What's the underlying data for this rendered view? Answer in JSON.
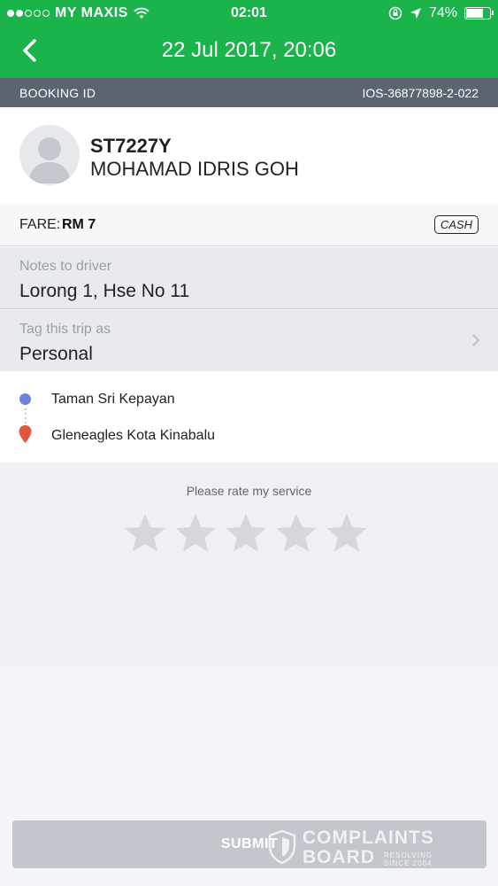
{
  "status_bar": {
    "carrier": "MY MAXIS",
    "time": "02:01",
    "battery": "74%",
    "battery_level": 0.74,
    "signal_bars_filled": 2,
    "signal_bars_total": 5
  },
  "header": {
    "title": "22 Jul 2017, 20:06",
    "back_icon": "chevron-left-icon",
    "background_color": "#1ab44a"
  },
  "booking": {
    "label": "BOOKING ID",
    "id": "IOS-36877898-2-022"
  },
  "driver": {
    "plate": "ST7227Y",
    "name": "MOHAMAD IDRIS GOH"
  },
  "fare": {
    "label": "FARE:",
    "amount": "RM 7",
    "payment": "CASH"
  },
  "notes": {
    "label": "Notes to driver",
    "value": "Lorong 1, Hse No 11"
  },
  "tag": {
    "label": "Tag this trip as",
    "value": "Personal"
  },
  "route": {
    "pickup": "Taman Sri Kepayan",
    "dropoff": "Gleneagles Kota Kinabalu",
    "pickup_color": "#6f7fe0",
    "dropoff_color": "#e0573d"
  },
  "rating": {
    "prompt": "Please rate my service",
    "stars_total": 5,
    "stars_selected": 0
  },
  "submit": {
    "label": "SUBMIT"
  },
  "watermark": {
    "line1": "COMPLAINTS",
    "line2": "BOARD",
    "tag1": "RESOLVING",
    "tag2": "SINCE 2004"
  }
}
